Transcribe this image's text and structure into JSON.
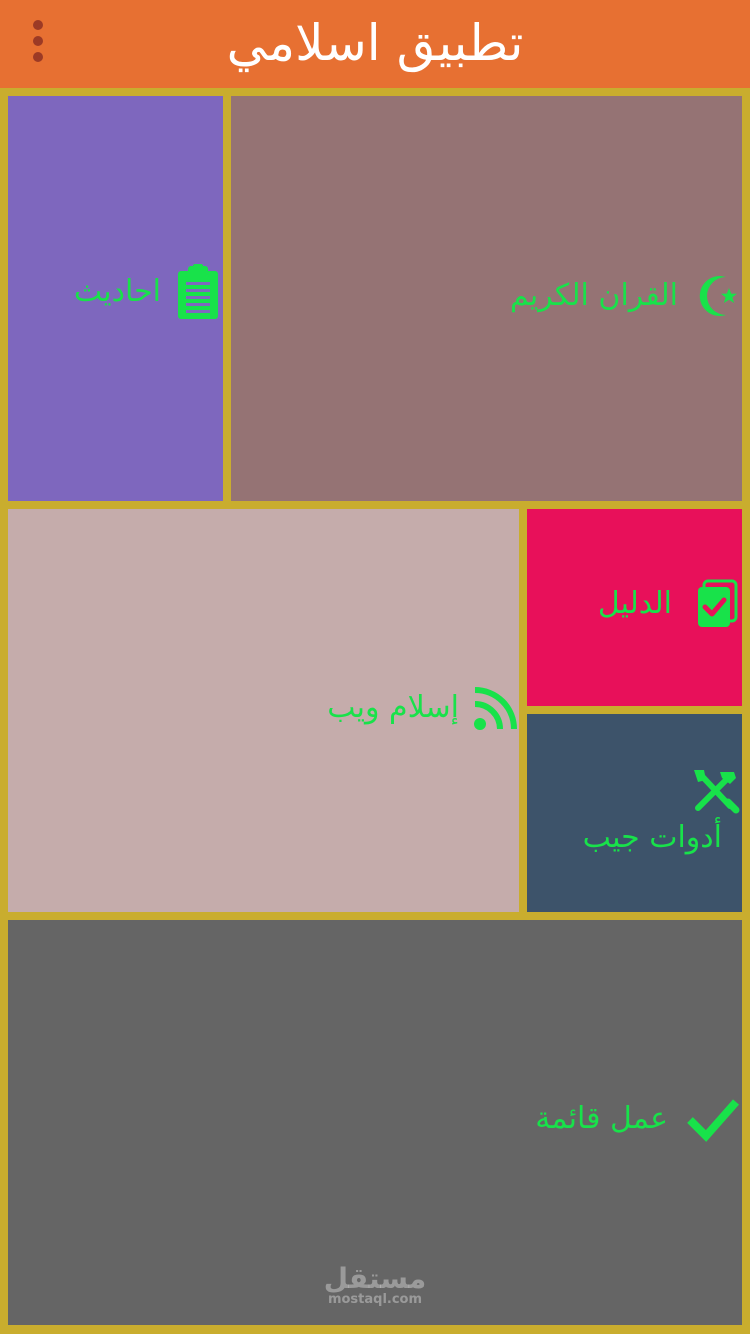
{
  "appbar": {
    "title": "تطبيق اسلامي",
    "menu_icon": "more-vert-icon",
    "background": "#e77032"
  },
  "tiles": [
    {
      "id": "hadith",
      "label": "احاديث",
      "icon": "clipboard-icon",
      "background": "#7e67be"
    },
    {
      "id": "quran",
      "label": "القران الكريم",
      "icon": "crescent-star-icon",
      "background": "#957374"
    },
    {
      "id": "islamweb",
      "label": "إسلام ويب",
      "icon": "rss-icon",
      "background": "#c5acab"
    },
    {
      "id": "guide",
      "label": "الدليل",
      "icon": "checklist-book-icon",
      "background": "#e8105a"
    },
    {
      "id": "tools",
      "label": "أدوات جيب",
      "icon": "tools-icon",
      "background": "#3d536a"
    },
    {
      "id": "todo",
      "label": "عمل قائمة",
      "icon": "checkmark-icon",
      "background": "#656565"
    }
  ],
  "watermark": {
    "arabic": "مستقل",
    "latin": "mostaql.com"
  },
  "colors": {
    "grid_gap": "#c9ad2e",
    "label_text": "#18e24a"
  }
}
